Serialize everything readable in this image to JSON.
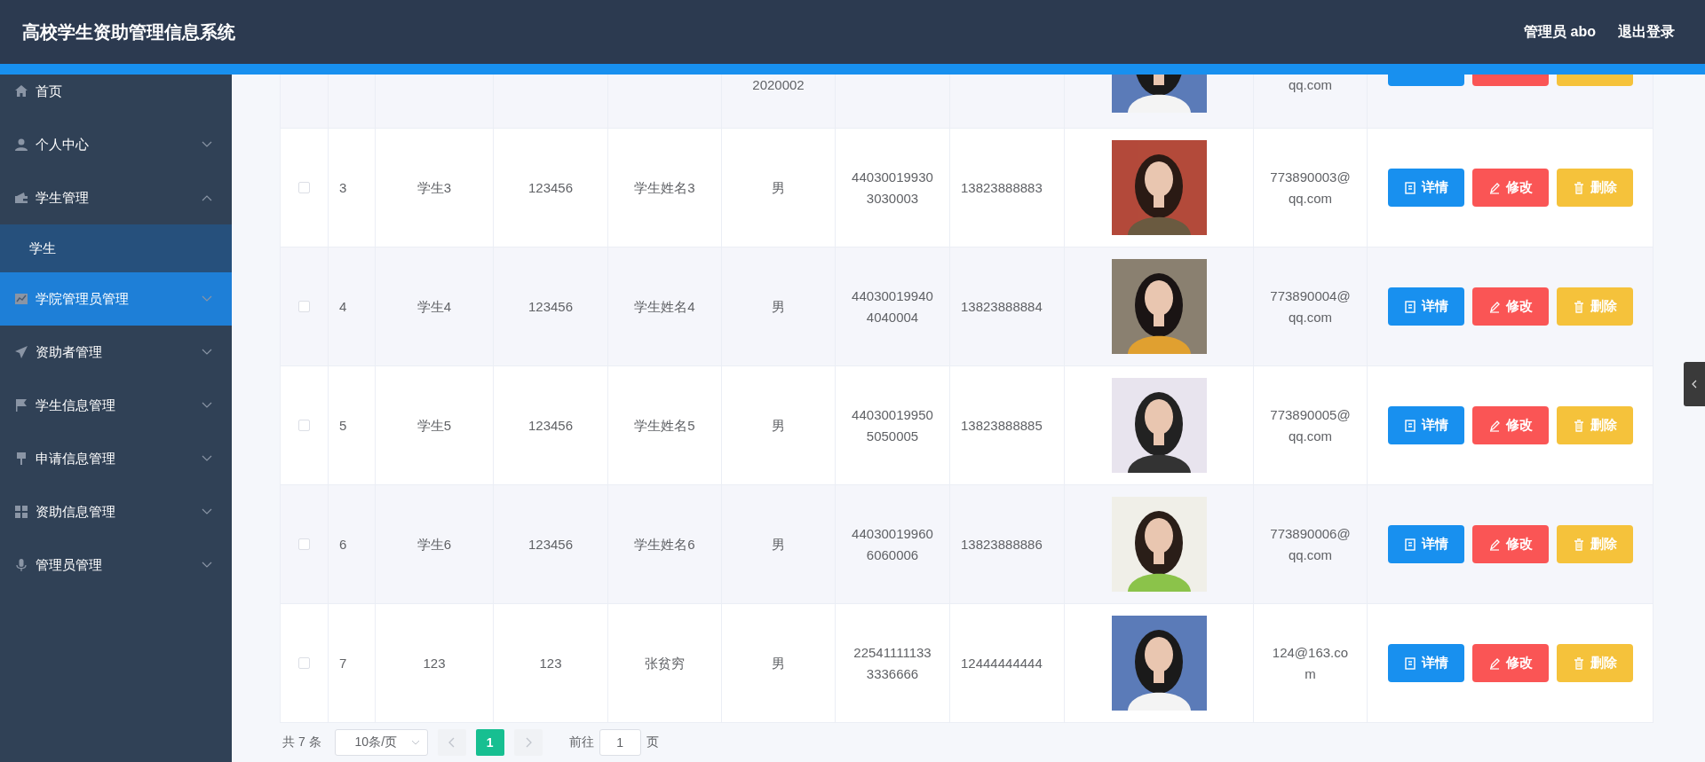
{
  "header": {
    "title": "高校学生资助管理信息系统",
    "user": "管理员 abo",
    "logout": "退出登录"
  },
  "sidebar": {
    "items": [
      {
        "label": "首页",
        "selected": false
      },
      {
        "label": "个人中心",
        "selected": false,
        "expanded": false
      },
      {
        "label": "学生管理",
        "selected": false,
        "expanded": true,
        "children": [
          {
            "label": "学生",
            "selected": false
          }
        ]
      },
      {
        "label": "学院管理员管理",
        "selected": true,
        "expanded": false
      },
      {
        "label": "资助者管理",
        "selected": false,
        "expanded": false
      },
      {
        "label": "学生信息管理",
        "selected": false,
        "expanded": false
      },
      {
        "label": "申请信息管理",
        "selected": false,
        "expanded": false
      },
      {
        "label": "资助信息管理",
        "selected": false,
        "expanded": false
      },
      {
        "label": "管理员管理",
        "selected": false,
        "expanded": false
      }
    ]
  },
  "table": {
    "partial_row": {
      "column_6": "2020002",
      "column_10": "qq.com",
      "actions": [
        {
          "kind": "details"
        },
        {
          "kind": "edit"
        },
        {
          "kind": "delete"
        }
      ]
    },
    "rows": [
      {
        "checked": false,
        "cells": [
          "3",
          "学生3",
          "123456",
          "学生姓名3",
          "男",
          "440300199303030003",
          "13823888883"
        ],
        "email": "773890003@qq.com",
        "actions": [
          {
            "kind": "details",
            "label": "详情"
          },
          {
            "kind": "edit",
            "label": "修改"
          },
          {
            "kind": "delete",
            "label": "删除"
          }
        ]
      },
      {
        "checked": false,
        "cells": [
          "4",
          "学生4",
          "123456",
          "学生姓名4",
          "男",
          "440300199404040004",
          "13823888884"
        ],
        "email": "773890004@qq.com",
        "actions": [
          {
            "kind": "details",
            "label": "详情"
          },
          {
            "kind": "edit",
            "label": "修改"
          },
          {
            "kind": "delete",
            "label": "删除"
          }
        ]
      },
      {
        "checked": false,
        "cells": [
          "5",
          "学生5",
          "123456",
          "学生姓名5",
          "男",
          "440300199505050005",
          "13823888885"
        ],
        "email": "773890005@qq.com",
        "actions": [
          {
            "kind": "details",
            "label": "详情"
          },
          {
            "kind": "edit",
            "label": "修改"
          },
          {
            "kind": "delete",
            "label": "删除"
          }
        ]
      },
      {
        "checked": false,
        "cells": [
          "6",
          "学生6",
          "123456",
          "学生姓名6",
          "男",
          "440300199606060006",
          "13823888886"
        ],
        "email": "773890006@qq.com",
        "actions": [
          {
            "kind": "details",
            "label": "详情"
          },
          {
            "kind": "edit",
            "label": "修改"
          },
          {
            "kind": "delete",
            "label": "删除"
          }
        ]
      },
      {
        "checked": false,
        "cells": [
          "7",
          "123",
          "123",
          "张贫穷",
          "男",
          "225411111333336666",
          "12444444444"
        ],
        "email": "124@163.com",
        "actions": [
          {
            "kind": "details",
            "label": "详情"
          },
          {
            "kind": "edit",
            "label": "修改"
          },
          {
            "kind": "delete",
            "label": "删除"
          }
        ]
      }
    ]
  },
  "pagination": {
    "total": "共 7 条",
    "page_size": "10条/页",
    "pages": [
      {
        "label": "1",
        "selected": true
      }
    ],
    "goto_label": "前往",
    "goto_value": "1",
    "goto_suffix": "页"
  }
}
